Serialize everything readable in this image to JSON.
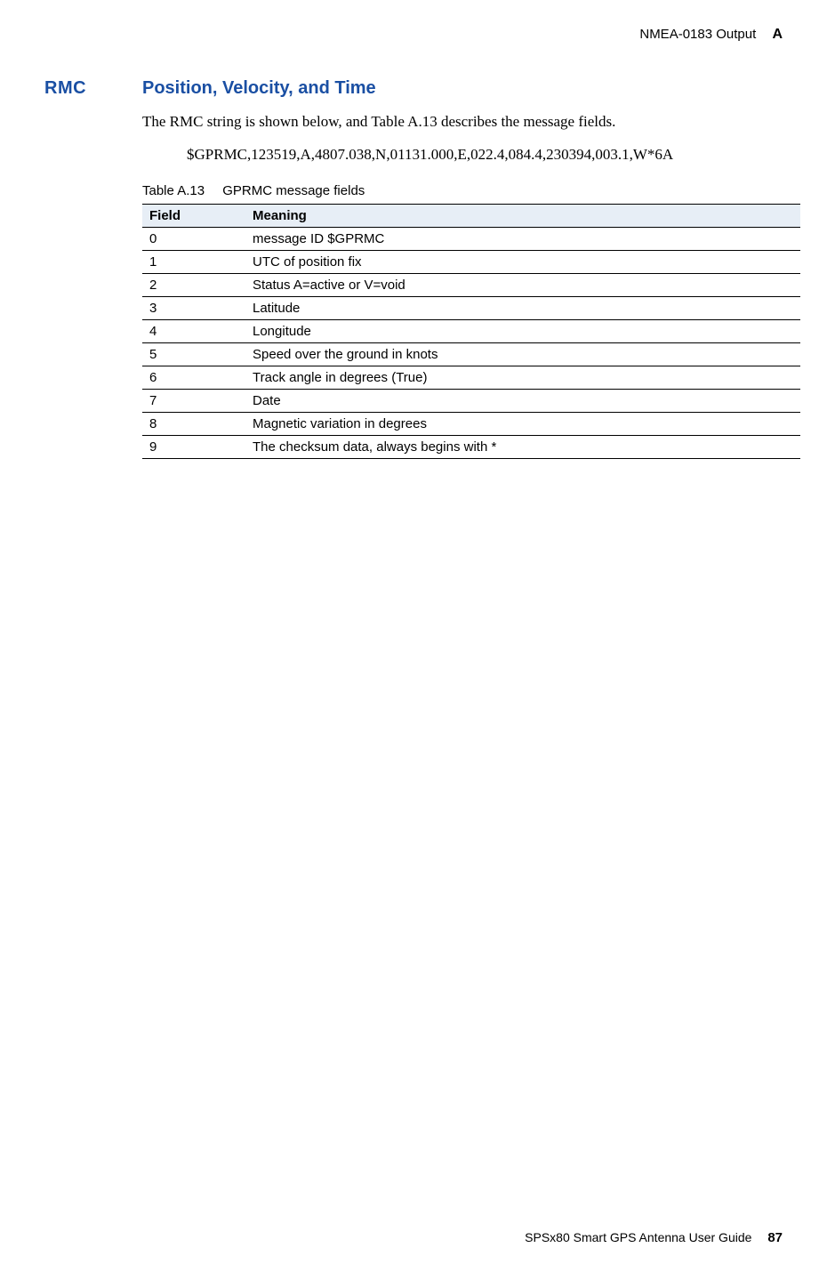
{
  "header": {
    "chapter": "NMEA-0183 Output",
    "appendix": "A"
  },
  "section": {
    "key": "RMC",
    "title": "Position, Velocity, and Time"
  },
  "intro": "The RMC string is shown below, and Table A.13 describes the message fields.",
  "example": "$GPRMC,123519,A,4807.038,N,01131.000,E,022.4,084.4,230394,003.1,W*6A",
  "table": {
    "number": "Table A.13",
    "title": "GPRMC message fields",
    "headers": {
      "field": "Field",
      "meaning": "Meaning"
    },
    "rows": [
      {
        "field": "0",
        "meaning": "message ID $GPRMC"
      },
      {
        "field": "1",
        "meaning": "UTC of position fix"
      },
      {
        "field": "2",
        "meaning": "Status A=active or V=void"
      },
      {
        "field": "3",
        "meaning": "Latitude"
      },
      {
        "field": "4",
        "meaning": "Longitude"
      },
      {
        "field": "5",
        "meaning": "Speed over the ground in knots"
      },
      {
        "field": "6",
        "meaning": "Track angle in degrees (True)"
      },
      {
        "field": "7",
        "meaning": "Date"
      },
      {
        "field": "8",
        "meaning": "Magnetic variation in degrees"
      },
      {
        "field": "9",
        "meaning": "The checksum data, always begins with *"
      }
    ]
  },
  "footer": {
    "guide": "SPSx80 Smart GPS Antenna User Guide",
    "page": "87"
  }
}
